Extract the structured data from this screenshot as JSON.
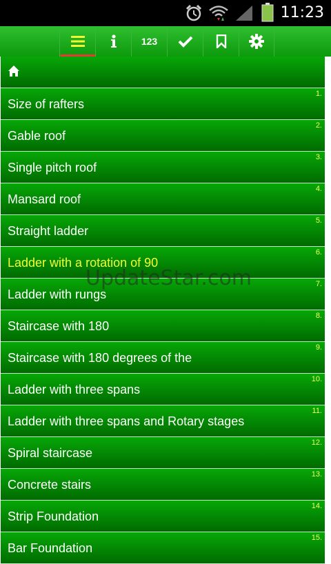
{
  "status_bar": {
    "time": "11:23",
    "icons": [
      "alarm-icon",
      "wifi-icon",
      "signal-icon",
      "battery-icon"
    ],
    "battery_color": "#8bc34a"
  },
  "toolbar": {
    "buttons": [
      {
        "name": "menu-icon"
      },
      {
        "name": "info-icon"
      },
      {
        "name": "numbers-button",
        "label": "123"
      },
      {
        "name": "check-icon"
      },
      {
        "name": "bookmark-icon"
      },
      {
        "name": "gear-icon"
      }
    ],
    "active_color": "#e53935"
  },
  "list": {
    "home_icon": "home-icon",
    "items": [
      {
        "label": "Size of rafters",
        "number": "1."
      },
      {
        "label": "Gable roof",
        "number": "2."
      },
      {
        "label": "Single pitch roof",
        "number": "3."
      },
      {
        "label": "Mansard roof",
        "number": "4."
      },
      {
        "label": "Straight ladder",
        "number": "5."
      },
      {
        "label": "Ladder with a rotation of 90",
        "number": "6."
      },
      {
        "label": "Ladder with rungs",
        "number": "7."
      },
      {
        "label": "Staircase with 180",
        "number": "8."
      },
      {
        "label": "Staircase with 180 degrees of the",
        "number": "9."
      },
      {
        "label": "Ladder with three spans",
        "number": "10."
      },
      {
        "label": "Ladder with three spans and Rotary stages",
        "number": "11."
      },
      {
        "label": "Spiral staircase",
        "number": "12."
      },
      {
        "label": "Concrete stairs",
        "number": "13."
      },
      {
        "label": "Strip Foundation",
        "number": "14."
      },
      {
        "label": "Bar Foundation",
        "number": "15."
      }
    ],
    "highlight_color": "#f3ff33"
  },
  "watermark": "UpdateStar.com"
}
